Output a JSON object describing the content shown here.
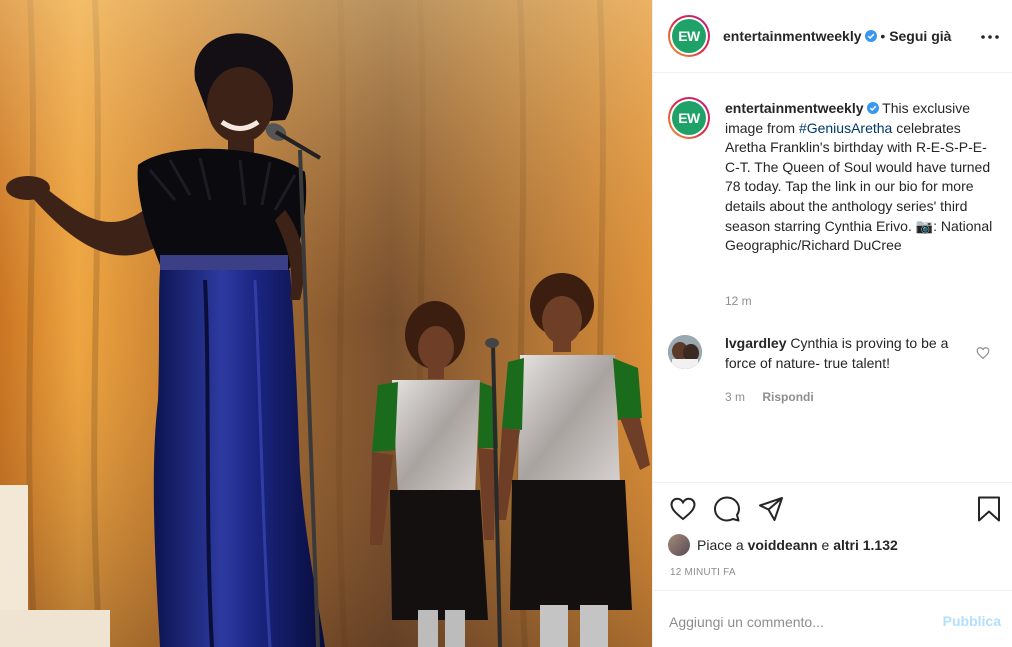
{
  "post": {
    "image_alt": "Cynthia Erivo as Aretha Franklin singing on stage with two backup singers",
    "author": {
      "username": "entertainmentweekly",
      "avatar_text": "EW",
      "verified": true,
      "brand_color": "#1fa268"
    },
    "header": {
      "separator": "•",
      "follow_label": "Segui già",
      "more_icon": "more-horizontal-icon"
    },
    "caption": {
      "text_before_hashtag": "This exclusive image from ",
      "hashtag": "#GeniusAretha",
      "text_after_hashtag": " celebrates Aretha Franklin's birthday with R-E-S-P-E-C-T. The Queen of Soul would have turned 78 today. Tap the link in our bio for more details about the anthology series' third season starring Cynthia Erivo. 📷: National Geographic/Richard DuCree",
      "time": "12 m"
    },
    "comments": [
      {
        "username": "lvgardley",
        "text": "Cynthia is proving to be a force of nature- true talent!",
        "time": "3 m",
        "reply_label": "Rispondi"
      }
    ],
    "actions": {
      "like_icon": "heart-icon",
      "comment_icon": "comment-icon",
      "share_icon": "share-icon",
      "save_icon": "bookmark-icon"
    },
    "likes": {
      "prefix": "Piace a ",
      "user": "voiddeann",
      "middle": " e ",
      "others": "altri 1.132"
    },
    "post_time": "12 MINUTI FA",
    "add_comment": {
      "placeholder": "Aggiungi un commento...",
      "publish_label": "Pubblica"
    }
  },
  "colors": {
    "link": "#00376b",
    "muted": "#8e8e8e",
    "publish_disabled": "#b2dffc",
    "verified": "#3897f0"
  }
}
